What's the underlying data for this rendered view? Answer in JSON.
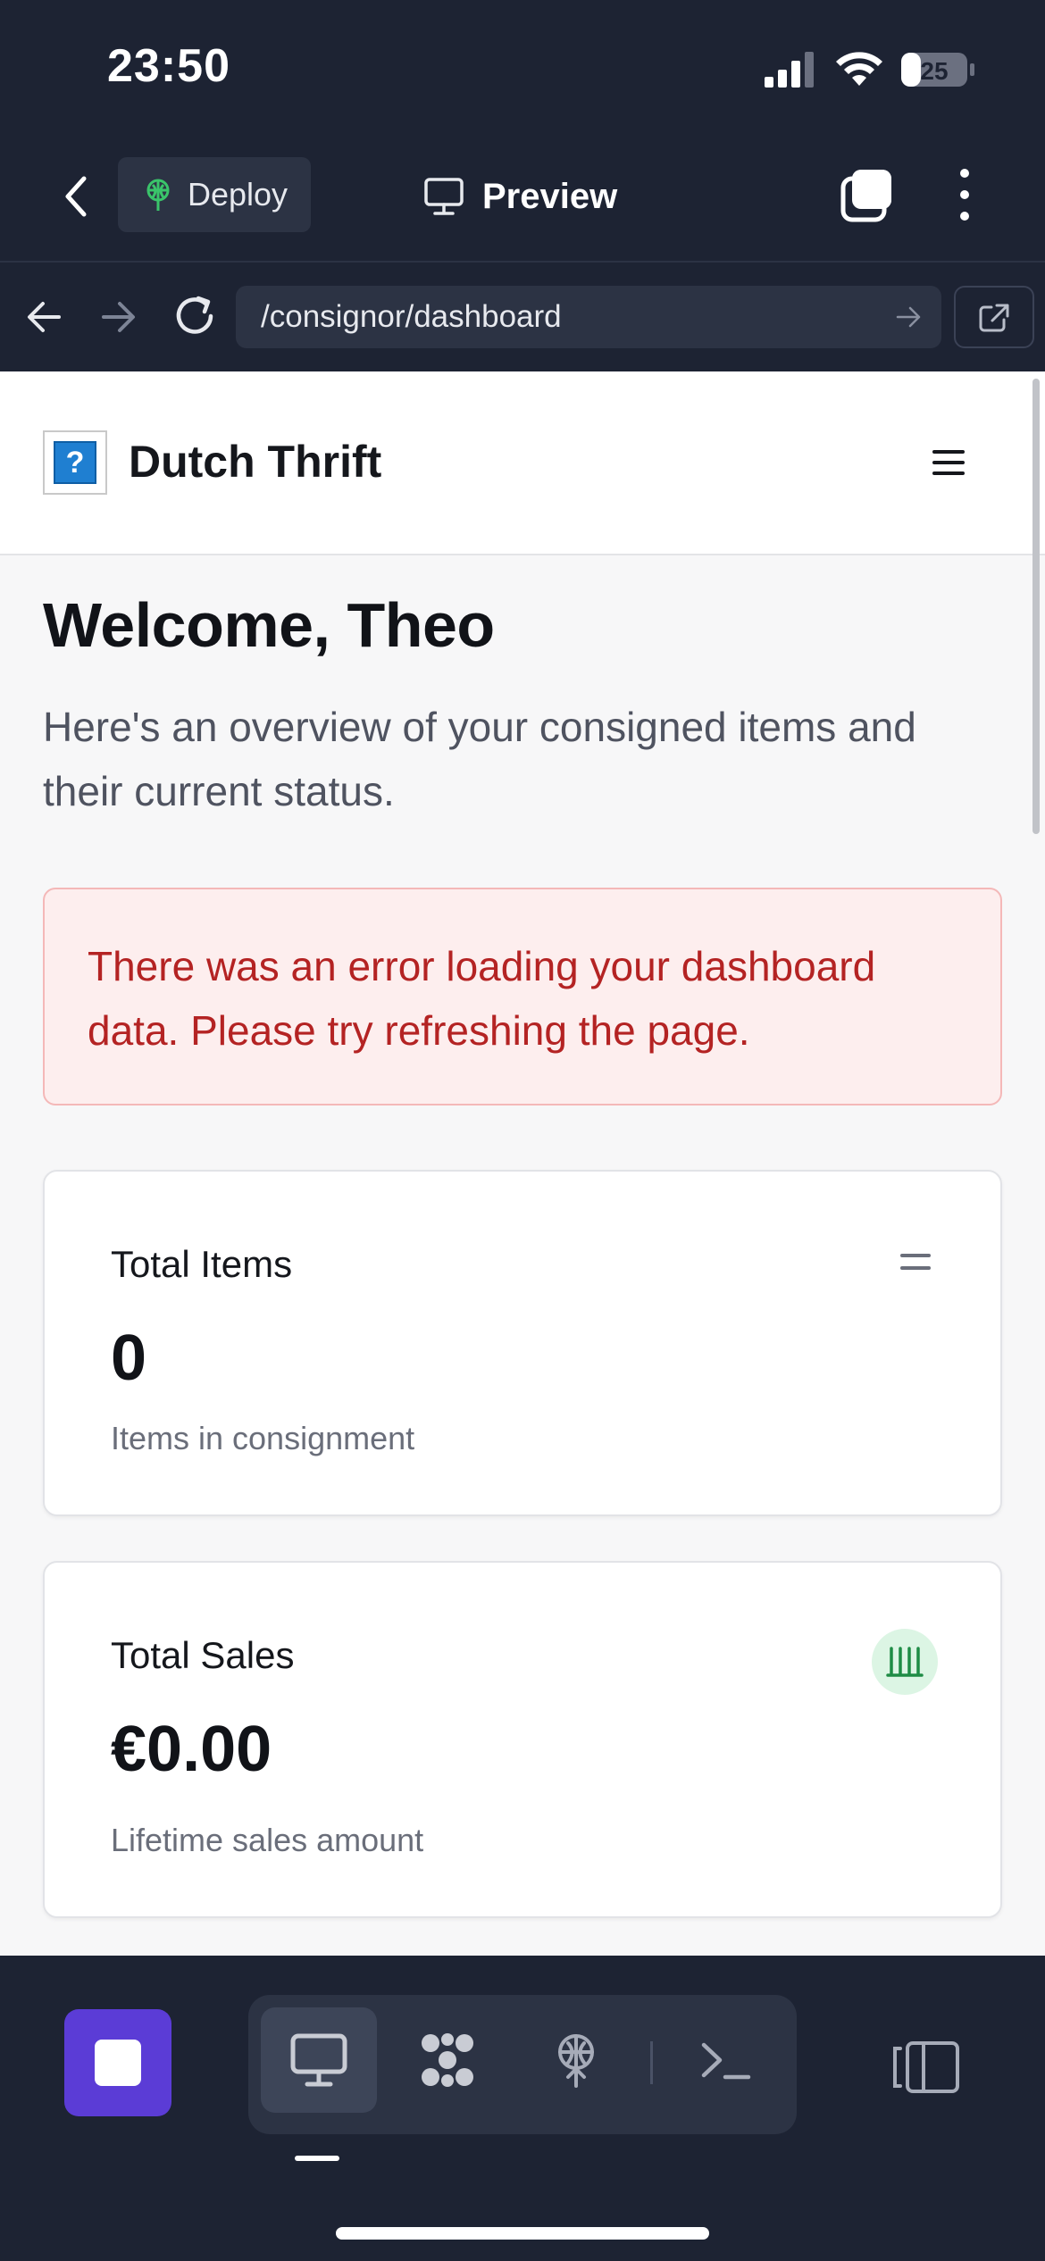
{
  "status_bar": {
    "time": "23:50",
    "battery": "25"
  },
  "toolbar": {
    "deploy_label": "Deploy",
    "preview_label": "Preview"
  },
  "browser": {
    "url": "/consignor/dashboard"
  },
  "site": {
    "logo_glyph": "?",
    "brand": "Dutch Thrift"
  },
  "page": {
    "welcome": "Welcome, Theo",
    "intro": "Here's an overview of your consigned items and their current status.",
    "error": "There was an error loading your dashboard data. Please try refreshing the page."
  },
  "cards": [
    {
      "title": "Total Items",
      "value": "0",
      "subtitle": "Items in consignment",
      "icon": "equals-icon"
    },
    {
      "title": "Total Sales",
      "value": "€0.00",
      "subtitle": "Lifetime sales amount",
      "icon": "bank-icon"
    }
  ],
  "dock": {
    "items": [
      "monitor-icon",
      "packages-icon",
      "deploy-icon",
      "terminal-icon"
    ],
    "active": "monitor-icon"
  },
  "colors": {
    "chrome": "#1d2333",
    "accent": "#5b3cd6",
    "error_text": "#b42323",
    "error_bg": "#fdeeee",
    "success_bg": "#dcf5e4",
    "success_icon": "#1e8c45"
  }
}
